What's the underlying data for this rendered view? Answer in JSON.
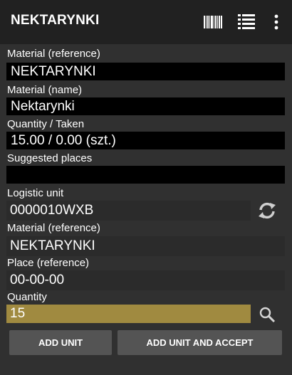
{
  "appbar": {
    "title": "NEKTARYNKI",
    "icons": [
      "barcode-icon",
      "list-icon",
      "more-vert-icon"
    ]
  },
  "fields": {
    "material_ref_label": "Material (reference)",
    "material_ref_value": "NEKTARYNKI",
    "material_name_label": "Material (name)",
    "material_name_value": "Nektarynki",
    "quantity_taken_label": "Quantity / Taken",
    "quantity_taken_value": "15.00 / 0.00 (szt.)",
    "suggested_places_label": "Suggested places",
    "suggested_places_value": "",
    "logistic_unit_label": "Logistic unit",
    "logistic_unit_value": "0000010WXB",
    "material_ref2_label": "Material (reference)",
    "material_ref2_value": "NEKTARYNKI",
    "place_ref_label": "Place (reference)",
    "place_ref_value": "00-00-00",
    "quantity_label": "Quantity",
    "quantity_value": "15"
  },
  "buttons": {
    "add_unit": "ADD UNIT",
    "add_unit_accept": "ADD UNIT AND ACCEPT"
  },
  "colors": {
    "background": "#303030",
    "appbar": "#212121",
    "input_accent": "#a08a40",
    "button": "#545454"
  }
}
